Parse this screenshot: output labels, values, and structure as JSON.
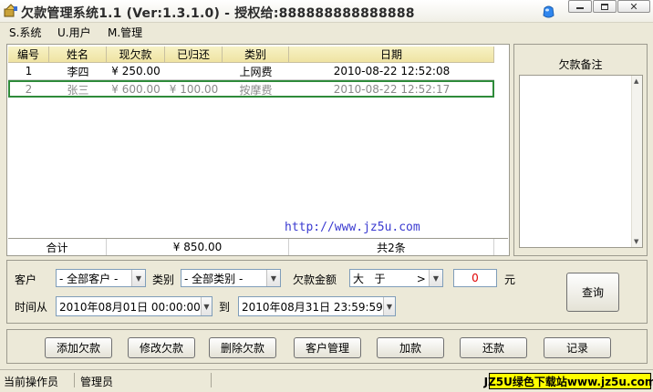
{
  "window": {
    "title": "欠款管理系统1.1 (Ver:1.3.1.0) - 授权给:888888888888888"
  },
  "menu": {
    "items": [
      {
        "label": "S.系统"
      },
      {
        "label": "U.用户"
      },
      {
        "label": "M.管理"
      }
    ]
  },
  "grid": {
    "columns": [
      "编号",
      "姓名",
      "现欠款",
      "已归还",
      "类别",
      "日期"
    ],
    "rows": [
      {
        "id": "1",
        "name": "李四",
        "owed": "¥ 250.00",
        "returned": "",
        "category": "上网费",
        "date": "2010-08-22 12:52:08"
      },
      {
        "id": "2",
        "name": "张三",
        "owed": "¥ 600.00",
        "returned": "¥ 100.00",
        "category": "按摩费",
        "date": "2010-08-22 12:52:17"
      }
    ],
    "footer": {
      "label": "合计",
      "total": "¥ 850.00",
      "count": "共2条"
    },
    "watermark": "http://www.jz5u.com"
  },
  "notes": {
    "title": "欠款备注"
  },
  "filter": {
    "customer_label": "客户",
    "customer_value": "- 全部客户 -",
    "category_label": "类别",
    "category_value": "- 全部类别 -",
    "amount_label": "欠款金额",
    "operator_value": "大   于         >",
    "amount_value": "0",
    "amount_unit": "元",
    "time_from_label": "时间从",
    "time_from_value": "2010年08月01日 00:00:00",
    "time_to_label": "到",
    "time_to_value": "2010年08月31日 23:59:59",
    "query_label": "查询"
  },
  "actions": [
    {
      "label": "添加欠款"
    },
    {
      "label": "修改欠款"
    },
    {
      "label": "删除欠款"
    },
    {
      "label": "客户管理"
    },
    {
      "label": "加款"
    },
    {
      "label": "还款"
    },
    {
      "label": "记录"
    }
  ],
  "status": {
    "operator_label": "当前操作员",
    "operator_value": "管理员",
    "brand": "JZ5U绿色下载站www.jz5u.com"
  },
  "colors": {
    "header_bg": "#efe3a2",
    "selection_border": "#2e8b3a",
    "watermark": "#3a3ad0",
    "amount_text": "#e00000",
    "brand_bg": "#ffff00"
  }
}
